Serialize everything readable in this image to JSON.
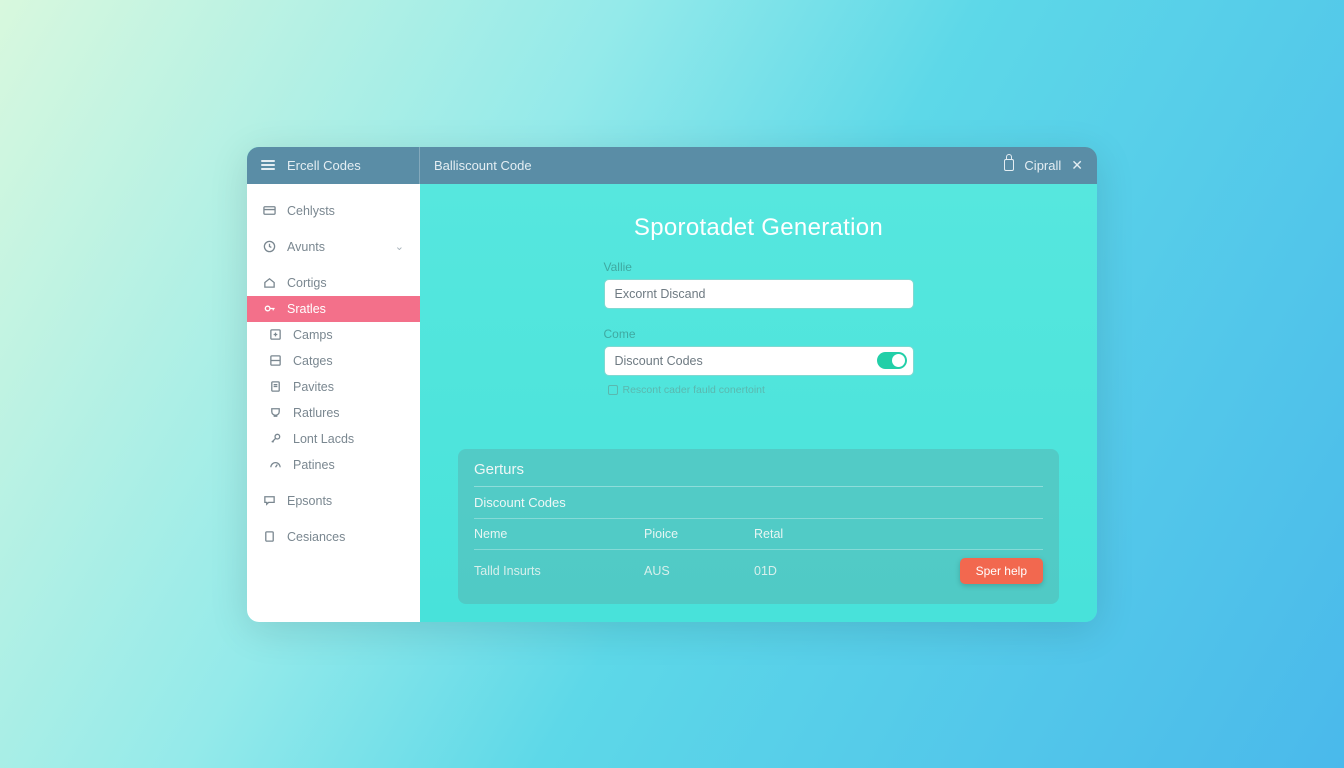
{
  "topbar": {
    "app_label": "Ercell Codes",
    "title": "Balliscount Code",
    "right_label": "Ciprall"
  },
  "sidebar": {
    "items": [
      {
        "label": "Cehlysts",
        "icon": "card"
      },
      {
        "label": "Avunts",
        "icon": "clock",
        "chevron": true
      },
      {
        "label": "Cortigs",
        "icon": "home"
      },
      {
        "label": "Sratles",
        "icon": "key",
        "active": true
      },
      {
        "label": "Camps",
        "icon": "plus-box"
      },
      {
        "label": "Catges",
        "icon": "layers"
      },
      {
        "label": "Pavites",
        "icon": "doc"
      },
      {
        "label": "Ratlures",
        "icon": "cup"
      },
      {
        "label": "Lont Lacds",
        "icon": "key2"
      },
      {
        "label": "Patines",
        "icon": "gauge"
      },
      {
        "label": "Epsonts",
        "icon": "chat"
      },
      {
        "label": "Cesiances",
        "icon": "device"
      }
    ]
  },
  "main": {
    "title": "Sporotadet Generation",
    "field1_label": "Vallie",
    "field1_value": "Excornt Discand",
    "field2_label": "Come",
    "field2_value": "Discount Codes",
    "helper_text": "Rescont cader fauld conertoint"
  },
  "panel": {
    "title": "Gerturs",
    "subtitle": "Discount Codes",
    "columns": [
      "Neme",
      "Pioice",
      "Retal"
    ],
    "row": [
      "Talld Insurts",
      "AUS",
      "01D"
    ],
    "button": "Sper help"
  }
}
